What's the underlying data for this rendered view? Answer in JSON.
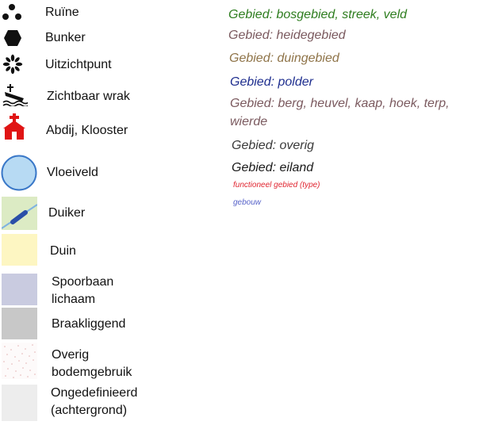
{
  "legend": {
    "ruine": "Ruïne",
    "bunker": "Bunker",
    "uitzichtpunt": "Uitzichtpunt",
    "wrak": "Zichtbaar wrak",
    "abdij": "Abdij, Klooster",
    "vloeiveld": "Vloeiveld",
    "duiker": "Duiker",
    "duin": "Duin",
    "spoorbaan": "Spoorbaan lichaam",
    "braak": "Braakliggend",
    "overig": "Overig bodemgebruik",
    "ongedefinieerd": "Ongedefinieerd (achtergrond)"
  },
  "areas": {
    "bos": "Gebied: bosgebied, streek, veld",
    "heide": "Gebied: heidegebied",
    "duin": "Gebied: duingebied",
    "polder": "Gebied: polder",
    "berg": "Gebied: berg, heuvel, kaap, hoek, terp, wierde",
    "overig": "Gebied: overig",
    "eiland": "Gebied: eiland",
    "functioneel": "functioneel gebied (type)",
    "gebouw": "gebouw"
  },
  "colors": {
    "bos": "#2e7d1f",
    "heide": "#7b5a5f",
    "duin": "#8f7449",
    "polder": "#1f2f8f",
    "berg": "#7b5a5f",
    "overig": "#3a3a3a",
    "eiland": "#1a1a1a",
    "functioneel": "#e0242f",
    "gebouw": "#5561c8",
    "vloeiveld_fill": "#b7daf3",
    "vloeiveld_stroke": "#3a78c8",
    "duiker_bg": "#dcebc4",
    "duin_bg": "#fdf6c2",
    "spoorbaan_bg": "#c9cbe0",
    "braak_bg": "#c8c8c8",
    "ongedefinieerd_bg": "#ededed",
    "abdij_red": "#e01414"
  },
  "icons": [
    "dots-cluster-icon",
    "hexagon-icon",
    "viewpoint-star-icon",
    "wreck-icon",
    "church-icon"
  ]
}
